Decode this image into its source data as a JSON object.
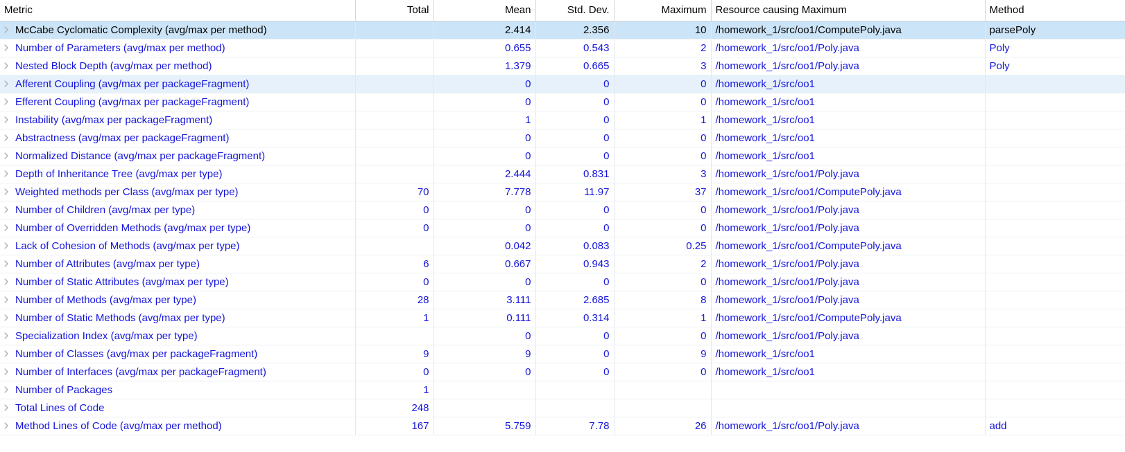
{
  "table": {
    "name": "metrics-table",
    "columns": [
      {
        "key": "metric",
        "label": "Metric",
        "align": "left"
      },
      {
        "key": "total",
        "label": "Total",
        "align": "right"
      },
      {
        "key": "mean",
        "label": "Mean",
        "align": "right"
      },
      {
        "key": "stddev",
        "label": "Std. Dev.",
        "align": "right"
      },
      {
        "key": "maximum",
        "label": "Maximum",
        "align": "right"
      },
      {
        "key": "resource",
        "label": "Resource causing Maximum",
        "align": "left"
      },
      {
        "key": "method",
        "label": "Method",
        "align": "left"
      }
    ],
    "expand_icon": "chevron-right-icon",
    "colors": {
      "link_text": "#1414dc",
      "selected_row_bg": "#cce4f7",
      "alt_row_bg": "#e6f1fb",
      "header_text": "#000000",
      "grid_line": "#e3e8ee",
      "chevron": "#b3b3b3"
    },
    "rows": [
      {
        "metric": "McCabe Cyclomatic Complexity (avg/max per method)",
        "total": "",
        "mean": "2.414",
        "stddev": "2.356",
        "maximum": "10",
        "resource": "/homework_1/src/oo1/ComputePoly.java",
        "method": "parsePoly",
        "selected": true,
        "alt": false
      },
      {
        "metric": "Number of Parameters (avg/max per method)",
        "total": "",
        "mean": "0.655",
        "stddev": "0.543",
        "maximum": "2",
        "resource": "/homework_1/src/oo1/Poly.java",
        "method": "Poly",
        "selected": false,
        "alt": false
      },
      {
        "metric": "Nested Block Depth (avg/max per method)",
        "total": "",
        "mean": "1.379",
        "stddev": "0.665",
        "maximum": "3",
        "resource": "/homework_1/src/oo1/Poly.java",
        "method": "Poly",
        "selected": false,
        "alt": false
      },
      {
        "metric": "Afferent Coupling (avg/max per packageFragment)",
        "total": "",
        "mean": "0",
        "stddev": "0",
        "maximum": "0",
        "resource": "/homework_1/src/oo1",
        "method": "",
        "selected": false,
        "alt": true
      },
      {
        "metric": "Efferent Coupling (avg/max per packageFragment)",
        "total": "",
        "mean": "0",
        "stddev": "0",
        "maximum": "0",
        "resource": "/homework_1/src/oo1",
        "method": "",
        "selected": false,
        "alt": false
      },
      {
        "metric": "Instability (avg/max per packageFragment)",
        "total": "",
        "mean": "1",
        "stddev": "0",
        "maximum": "1",
        "resource": "/homework_1/src/oo1",
        "method": "",
        "selected": false,
        "alt": false
      },
      {
        "metric": "Abstractness (avg/max per packageFragment)",
        "total": "",
        "mean": "0",
        "stddev": "0",
        "maximum": "0",
        "resource": "/homework_1/src/oo1",
        "method": "",
        "selected": false,
        "alt": false
      },
      {
        "metric": "Normalized Distance (avg/max per packageFragment)",
        "total": "",
        "mean": "0",
        "stddev": "0",
        "maximum": "0",
        "resource": "/homework_1/src/oo1",
        "method": "",
        "selected": false,
        "alt": false
      },
      {
        "metric": "Depth of Inheritance Tree (avg/max per type)",
        "total": "",
        "mean": "2.444",
        "stddev": "0.831",
        "maximum": "3",
        "resource": "/homework_1/src/oo1/Poly.java",
        "method": "",
        "selected": false,
        "alt": false
      },
      {
        "metric": "Weighted methods per Class (avg/max per type)",
        "total": "70",
        "mean": "7.778",
        "stddev": "11.97",
        "maximum": "37",
        "resource": "/homework_1/src/oo1/ComputePoly.java",
        "method": "",
        "selected": false,
        "alt": false
      },
      {
        "metric": "Number of Children (avg/max per type)",
        "total": "0",
        "mean": "0",
        "stddev": "0",
        "maximum": "0",
        "resource": "/homework_1/src/oo1/Poly.java",
        "method": "",
        "selected": false,
        "alt": false
      },
      {
        "metric": "Number of Overridden Methods (avg/max per type)",
        "total": "0",
        "mean": "0",
        "stddev": "0",
        "maximum": "0",
        "resource": "/homework_1/src/oo1/Poly.java",
        "method": "",
        "selected": false,
        "alt": false
      },
      {
        "metric": "Lack of Cohesion of Methods (avg/max per type)",
        "total": "",
        "mean": "0.042",
        "stddev": "0.083",
        "maximum": "0.25",
        "resource": "/homework_1/src/oo1/ComputePoly.java",
        "method": "",
        "selected": false,
        "alt": false
      },
      {
        "metric": "Number of Attributes (avg/max per type)",
        "total": "6",
        "mean": "0.667",
        "stddev": "0.943",
        "maximum": "2",
        "resource": "/homework_1/src/oo1/Poly.java",
        "method": "",
        "selected": false,
        "alt": false
      },
      {
        "metric": "Number of Static Attributes (avg/max per type)",
        "total": "0",
        "mean": "0",
        "stddev": "0",
        "maximum": "0",
        "resource": "/homework_1/src/oo1/Poly.java",
        "method": "",
        "selected": false,
        "alt": false
      },
      {
        "metric": "Number of Methods (avg/max per type)",
        "total": "28",
        "mean": "3.111",
        "stddev": "2.685",
        "maximum": "8",
        "resource": "/homework_1/src/oo1/Poly.java",
        "method": "",
        "selected": false,
        "alt": false
      },
      {
        "metric": "Number of Static Methods (avg/max per type)",
        "total": "1",
        "mean": "0.111",
        "stddev": "0.314",
        "maximum": "1",
        "resource": "/homework_1/src/oo1/ComputePoly.java",
        "method": "",
        "selected": false,
        "alt": false
      },
      {
        "metric": "Specialization Index (avg/max per type)",
        "total": "",
        "mean": "0",
        "stddev": "0",
        "maximum": "0",
        "resource": "/homework_1/src/oo1/Poly.java",
        "method": "",
        "selected": false,
        "alt": false
      },
      {
        "metric": "Number of Classes (avg/max per packageFragment)",
        "total": "9",
        "mean": "9",
        "stddev": "0",
        "maximum": "9",
        "resource": "/homework_1/src/oo1",
        "method": "",
        "selected": false,
        "alt": false
      },
      {
        "metric": "Number of Interfaces (avg/max per packageFragment)",
        "total": "0",
        "mean": "0",
        "stddev": "0",
        "maximum": "0",
        "resource": "/homework_1/src/oo1",
        "method": "",
        "selected": false,
        "alt": false
      },
      {
        "metric": "Number of Packages",
        "total": "1",
        "mean": "",
        "stddev": "",
        "maximum": "",
        "resource": "",
        "method": "",
        "selected": false,
        "alt": false
      },
      {
        "metric": "Total Lines of Code",
        "total": "248",
        "mean": "",
        "stddev": "",
        "maximum": "",
        "resource": "",
        "method": "",
        "selected": false,
        "alt": false
      },
      {
        "metric": "Method Lines of Code (avg/max per method)",
        "total": "167",
        "mean": "5.759",
        "stddev": "7.78",
        "maximum": "26",
        "resource": "/homework_1/src/oo1/Poly.java",
        "method": "add",
        "selected": false,
        "alt": false
      }
    ]
  }
}
